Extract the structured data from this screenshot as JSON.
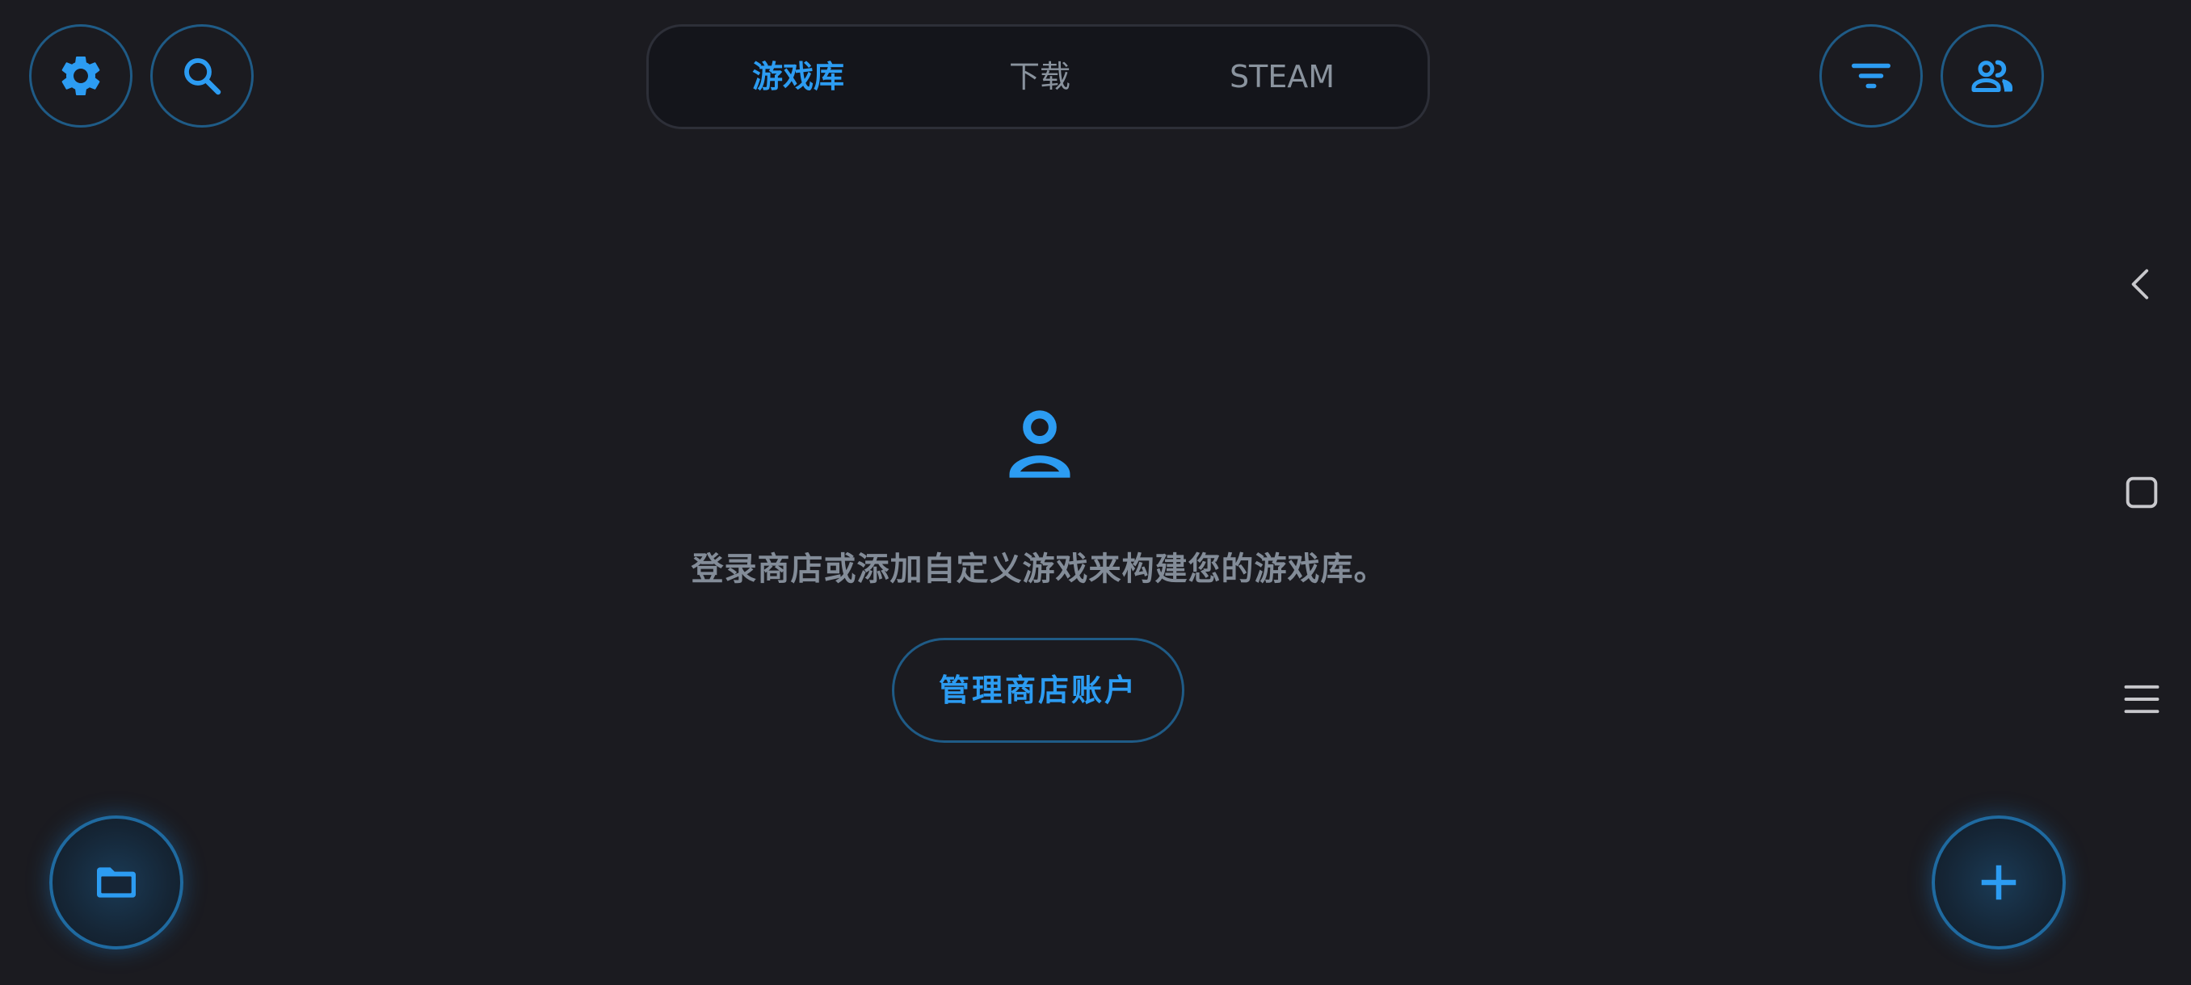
{
  "tabs": [
    {
      "label": "游戏库",
      "active": true
    },
    {
      "label": "下载",
      "active": false
    },
    {
      "label": "STEAM",
      "active": false
    }
  ],
  "icons": {
    "settings": "gear-icon",
    "search": "search-icon",
    "filter": "filter-icon",
    "accounts": "people-icon",
    "empty_state": "person-icon",
    "folder": "folder-icon",
    "add": "plus-icon"
  },
  "empty_state": {
    "message": "登录商店或添加自定义游戏来构建您的游戏库。",
    "button_label": "管理商店账户"
  },
  "colors": {
    "accent": "#2c9cf2",
    "background": "#1b1b20",
    "muted_text": "#838c98",
    "outline": "#1f5b86"
  }
}
